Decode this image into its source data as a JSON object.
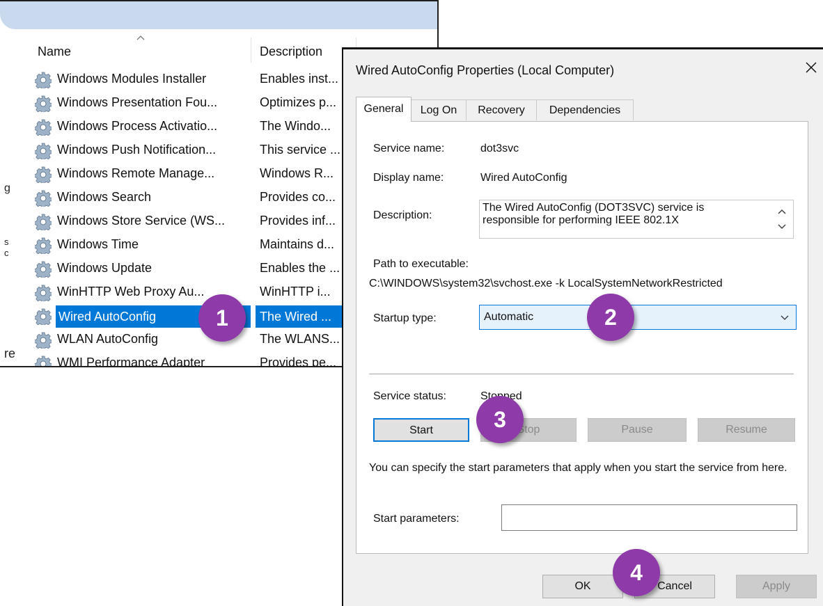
{
  "services_list": {
    "columns": {
      "name": "Name",
      "description": "Description"
    },
    "rows": [
      {
        "name": "Windows Modules Installer",
        "description": "Enables inst..."
      },
      {
        "name": "Windows Presentation Fou...",
        "description": "Optimizes p..."
      },
      {
        "name": "Windows Process Activatio...",
        "description": "The Windo..."
      },
      {
        "name": "Windows Push Notification...",
        "description": "This service ..."
      },
      {
        "name": "Windows Remote Manage...",
        "description": "Windows R..."
      },
      {
        "name": "Windows Search",
        "description": "Provides co..."
      },
      {
        "name": "Windows Store Service (WS...",
        "description": "Provides inf..."
      },
      {
        "name": "Windows Time",
        "description": "Maintains d..."
      },
      {
        "name": "Windows Update",
        "description": "Enables the ..."
      },
      {
        "name": "WinHTTP Web Proxy Au...",
        "description": "WinHTTP i..."
      },
      {
        "name": "Wired AutoConfig",
        "description": "The Wired ...",
        "selected": true
      },
      {
        "name": "WLAN AutoConfig",
        "description": "The WLANS..."
      },
      {
        "name": "WMI Performance Adapter",
        "description": "Provides pe..."
      }
    ],
    "edge_fragments": [
      "g",
      "s",
      "c",
      "re"
    ]
  },
  "dialog": {
    "title": "Wired AutoConfig Properties (Local Computer)",
    "tabs": [
      "General",
      "Log On",
      "Recovery",
      "Dependencies"
    ],
    "active_tab": "General",
    "service_name_label": "Service name:",
    "service_name": "dot3svc",
    "display_name_label": "Display name:",
    "display_name": "Wired AutoConfig",
    "description_label": "Description:",
    "description": "The Wired AutoConfig (DOT3SVC) service is responsible for performing IEEE 802.1X",
    "path_label": "Path to executable:",
    "path": "C:\\WINDOWS\\system32\\svchost.exe -k LocalSystemNetworkRestricted",
    "startup_type_label": "Startup type:",
    "startup_type": "Automatic",
    "service_status_label": "Service status:",
    "service_status": "Stopped",
    "control_buttons": {
      "start": "Start",
      "stop": "Stop",
      "pause": "Pause",
      "resume": "Resume"
    },
    "start_params_hint": "You can specify the start parameters that apply when you start the service from here.",
    "start_params_label": "Start parameters:",
    "start_params_value": "",
    "footer_buttons": {
      "ok": "OK",
      "cancel": "Cancel",
      "apply": "Apply"
    }
  },
  "callouts": [
    "1",
    "2",
    "3",
    "4"
  ],
  "colors": {
    "accent": "#0078d7",
    "callout": "#8e3aa8",
    "selection": "#0078d7"
  }
}
